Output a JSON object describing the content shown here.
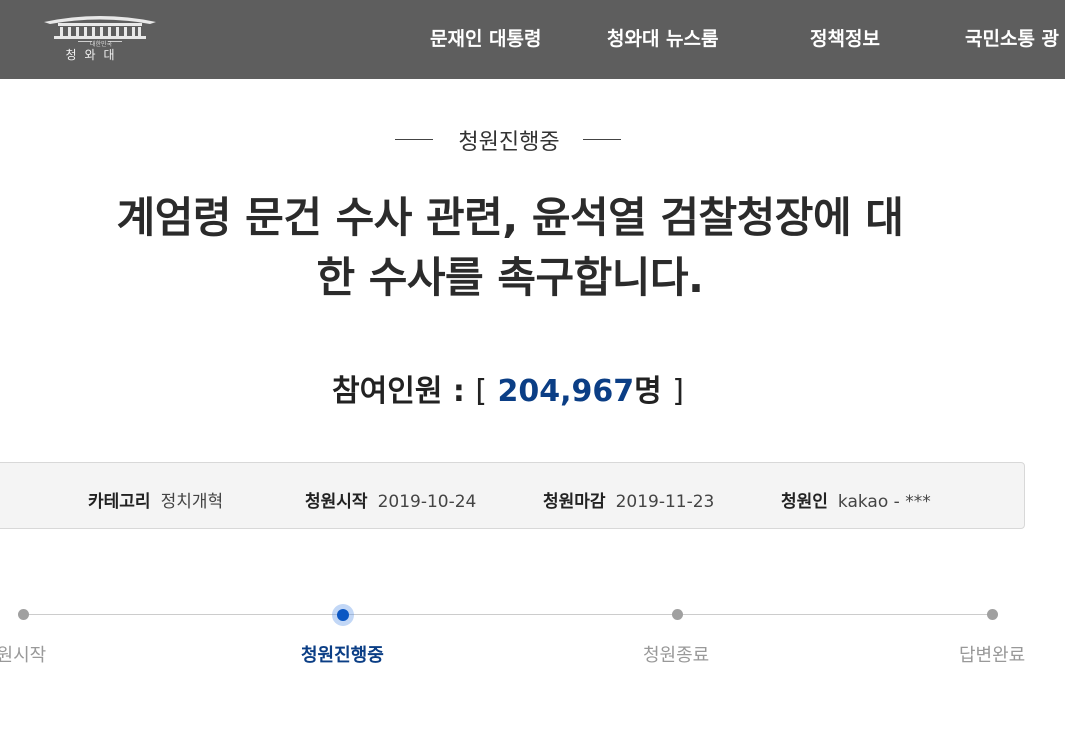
{
  "header": {
    "logo_text": "청와대",
    "logo_subtext": "대한민국",
    "nav": [
      "문재인 대통령",
      "청와대 뉴스룸",
      "정책정보",
      "국민소통 광"
    ]
  },
  "petition": {
    "status": "청원진행중",
    "title_line1": "계엄령 문건 수사 관련, 윤석열 검찰청장에 대",
    "title_line2": "한 수사를 촉구합니다.",
    "participants_label": "참여인원 :",
    "participants_open": "[",
    "participants_count": "204,967",
    "participants_unit": "명",
    "participants_close": "]"
  },
  "info": {
    "category_label": "카테고리",
    "category_value": "정치개혁",
    "start_label": "청원시작",
    "start_value": "2019-10-24",
    "end_label": "청원마감",
    "end_value": "2019-11-23",
    "author_label": "청원인",
    "author_value": "kakao - ***"
  },
  "progress": {
    "steps": [
      "청원시작",
      "청원진행중",
      "청원종료",
      "답변완료"
    ],
    "active_index": 1
  },
  "colors": {
    "header_bg": "#5e5e5e",
    "accent": "#0b3e85",
    "active_dot": "#0b57c3"
  }
}
